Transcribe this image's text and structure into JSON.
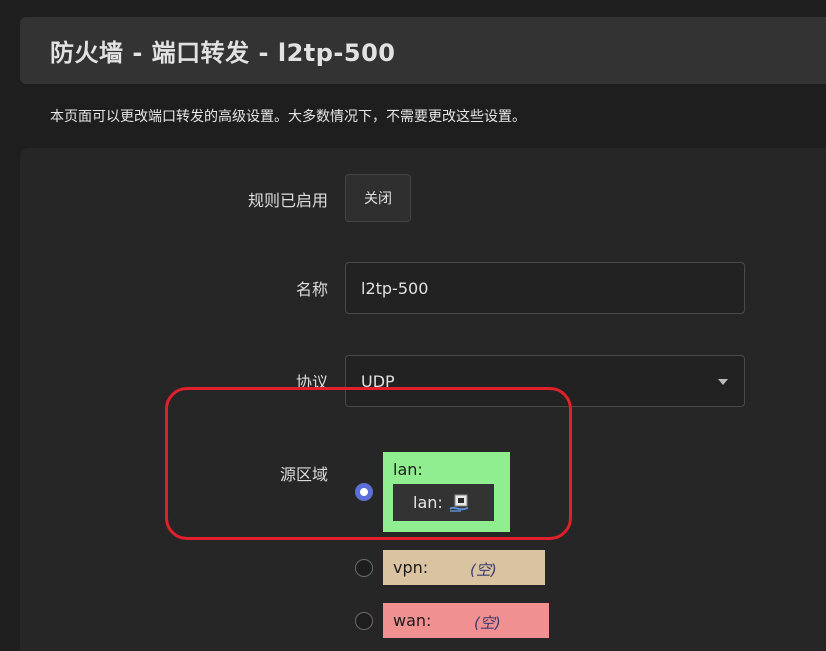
{
  "header": {
    "title": "防火墙 - 端口转发 - l2tp-500"
  },
  "description": "本页面可以更改端口转发的高级设置。大多数情况下，不需要更改这些设置。",
  "form": {
    "enabled": {
      "label": "规则已启用",
      "button": "关闭"
    },
    "name": {
      "label": "名称",
      "value": "l2tp-500"
    },
    "protocol": {
      "label": "协议",
      "selected": "UDP"
    },
    "source_zone": {
      "label": "源区域",
      "zones": [
        {
          "name": "lan:",
          "checked": true,
          "color": "#90ee90",
          "networks": [
            {
              "label": "lan:",
              "icon": "ethernet-port-icon"
            }
          ]
        },
        {
          "name": "vpn:",
          "checked": false,
          "color": "#d9c3a0",
          "empty": "(空)"
        },
        {
          "name": "wan:",
          "checked": false,
          "color": "#f09090",
          "empty": "(空)"
        }
      ]
    }
  },
  "colors": {
    "highlight": "#e0202a",
    "radio_accent": "#5b6fd6"
  }
}
